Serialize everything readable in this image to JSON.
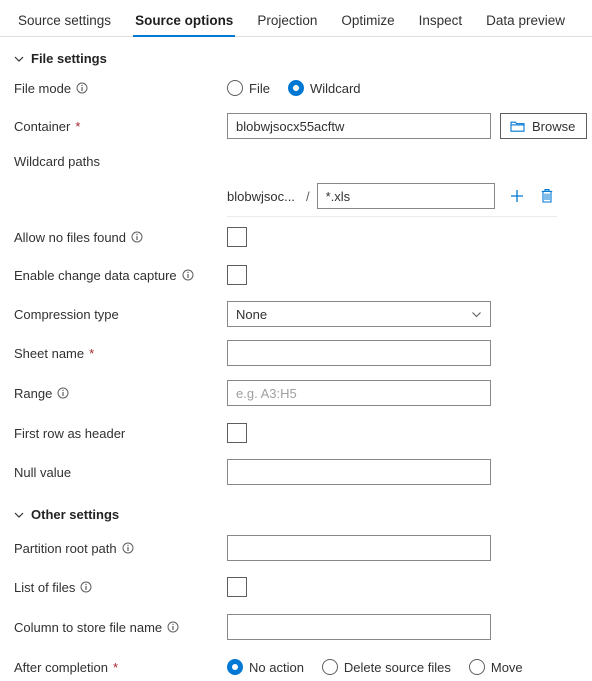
{
  "tabs": [
    {
      "label": "Source settings",
      "active": false
    },
    {
      "label": "Source options",
      "active": true
    },
    {
      "label": "Projection",
      "active": false
    },
    {
      "label": "Optimize",
      "active": false
    },
    {
      "label": "Inspect",
      "active": false
    },
    {
      "label": "Data preview",
      "active": false
    }
  ],
  "sections": {
    "file_settings": {
      "title": "File settings",
      "expanded": true
    },
    "other_settings": {
      "title": "Other settings",
      "expanded": true
    }
  },
  "fields": {
    "file_mode": {
      "label": "File mode",
      "has_info": true,
      "options": [
        "File",
        "Wildcard"
      ],
      "selected": "Wildcard"
    },
    "container": {
      "label": "Container",
      "required": true,
      "value": "blobwjsocx55acftw",
      "browse_label": "Browse"
    },
    "wildcard_paths": {
      "label": "Wildcard paths",
      "prefix": "blobwjsoc...",
      "separator": "/",
      "value": "*.xls",
      "add_icon": "plus-icon",
      "delete_icon": "trash-icon"
    },
    "allow_no_files_found": {
      "label": "Allow no files found",
      "has_info": true,
      "checked": false
    },
    "enable_change_data_capture": {
      "label": "Enable change data capture",
      "has_info": true,
      "checked": false
    },
    "compression_type": {
      "label": "Compression type",
      "value": "None"
    },
    "sheet_name": {
      "label": "Sheet name",
      "required": true,
      "value": ""
    },
    "range": {
      "label": "Range",
      "has_info": true,
      "placeholder": "e.g. A3:H5",
      "value": ""
    },
    "first_row_as_header": {
      "label": "First row as header",
      "checked": false
    },
    "null_value": {
      "label": "Null value",
      "value": ""
    },
    "partition_root_path": {
      "label": "Partition root path",
      "has_info": true,
      "value": ""
    },
    "list_of_files": {
      "label": "List of files",
      "has_info": true,
      "checked": false
    },
    "column_to_store_file_name": {
      "label": "Column to store file name",
      "has_info": true,
      "value": ""
    },
    "after_completion": {
      "label": "After completion",
      "required": true,
      "options": [
        "No action",
        "Delete source files",
        "Move"
      ],
      "selected": "No action"
    }
  },
  "colors": {
    "accent": "#0078d4",
    "required_marker": "#a4262c",
    "text": "#323130",
    "border": "#8a8886"
  }
}
